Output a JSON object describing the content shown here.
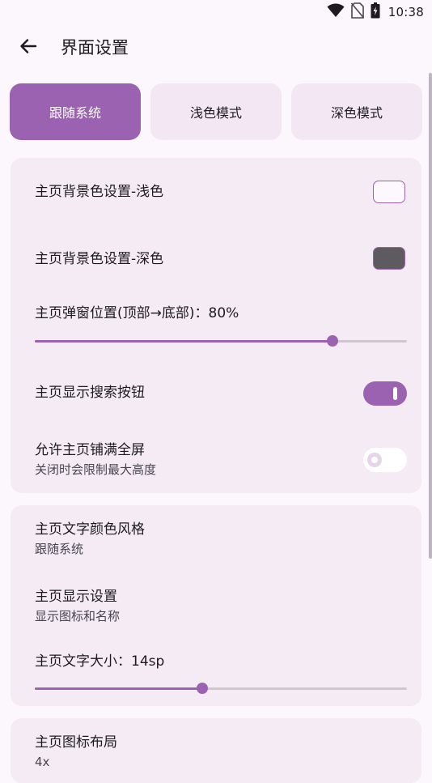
{
  "status_bar": {
    "time": "10:38",
    "icons": [
      "wifi-icon",
      "no-sim-icon",
      "battery-charging-icon"
    ]
  },
  "app_bar": {
    "back_icon": "arrow-left-icon",
    "title": "界面设置"
  },
  "theme_options": {
    "selected": "跟随系统",
    "items": [
      {
        "label": "跟随系统",
        "active": true
      },
      {
        "label": "浅色模式",
        "active": false
      },
      {
        "label": "深色模式",
        "active": false
      }
    ]
  },
  "card1": {
    "bg_light": {
      "label": "主页背景色设置-浅色",
      "color": "#fdf8fd"
    },
    "bg_dark": {
      "label": "主页背景色设置-深色",
      "color": "#5e5b60"
    },
    "popup_position": {
      "label": "主页弹窗位置(顶部→底部)：80%",
      "value_percent": 80
    },
    "search_button": {
      "label": "主页显示搜索按钮",
      "enabled": true
    },
    "fullscreen": {
      "label": "允许主页铺满全屏",
      "subtitle": "关闭时会限制最大高度",
      "enabled": false
    }
  },
  "card2": {
    "text_color_style": {
      "label": "主页文字颜色风格",
      "subtitle": "跟随系统"
    },
    "display_settings": {
      "label": "主页显示设置",
      "subtitle": "显示图标和名称"
    },
    "text_size": {
      "label": "主页文字大小：14sp",
      "value_fraction": 0.45
    }
  },
  "card3": {
    "icon_layout": {
      "label": "主页图标布局",
      "subtitle": "4x"
    }
  },
  "colors": {
    "accent": "#9a62b0",
    "surface": "#fcf7fc",
    "card": "#f4ebf5"
  }
}
